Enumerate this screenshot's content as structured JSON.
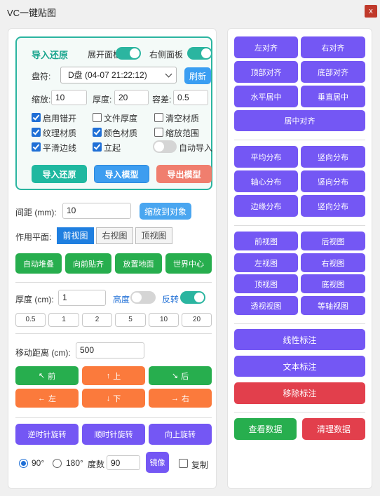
{
  "window": {
    "title": "VC一键贴图",
    "close_label": "x"
  },
  "import": {
    "section_title": "导入还原",
    "expand_panel_label": "展开面板",
    "side_panel_label": "右侧面板",
    "drive_label": "盘符:",
    "drive_value": "D盘 (04-07 21:22:12)",
    "refresh_label": "刷新",
    "scale_label": "缩放:",
    "scale_value": "10",
    "thickness_label": "厚度:",
    "thickness_value": "20",
    "tolerance_label": "容差:",
    "tolerance_value": "0.5",
    "checkboxes": [
      {
        "label": "启用错开",
        "checked": true
      },
      {
        "label": "文件厚度",
        "checked": false
      },
      {
        "label": "清空材质",
        "checked": false
      },
      {
        "label": "纹理材质",
        "checked": true
      },
      {
        "label": "颜色材质",
        "checked": true
      },
      {
        "label": "缩放范围",
        "checked": false
      },
      {
        "label": "平滑边线",
        "checked": true
      },
      {
        "label": "立起",
        "checked": true
      }
    ],
    "auto_import_label": "自动导入",
    "btn_restore": "导入还原",
    "btn_model": "导入模型",
    "btn_export": "导出模型"
  },
  "spacing": {
    "label": "间距 (mm):",
    "value": "10",
    "fit_button": "缩放到对象",
    "plane_label": "作用平面:",
    "planes": [
      "前视图",
      "右视图",
      "顶视图"
    ],
    "actions": [
      "自动堆叠",
      "向前贴齐",
      "放置地面",
      "世界中心"
    ]
  },
  "thickness": {
    "label": "厚度 (cm):",
    "value": "1",
    "height_label": "高度",
    "invert_label": "反转",
    "presets": [
      "0.5",
      "1",
      "2",
      "5",
      "10",
      "20"
    ]
  },
  "move": {
    "label": "移动距离 (cm):",
    "value": "500",
    "buttons": [
      "前",
      "上",
      "后",
      "左",
      "下",
      "右"
    ]
  },
  "rotate": {
    "buttons": [
      "逆时针旋转",
      "顺时针旋转",
      "向上旋转"
    ],
    "deg90": "90°",
    "deg180": "180°",
    "degree_label": "度数",
    "degree_value": "90",
    "mirror_label": "镜像",
    "copy_label": "复制"
  },
  "right": {
    "align": [
      "左对齐",
      "右对齐",
      "顶部对齐",
      "底部对齐",
      "水平居中",
      "垂直居中"
    ],
    "center_align": "居中对齐",
    "distribute": [
      "平均分布",
      "竖向分布",
      "轴心分布",
      "竖向分布",
      "边缘分布",
      "竖向分布"
    ],
    "views": [
      "前视图",
      "后视图",
      "左视图",
      "右视图",
      "顶视图",
      "底视图",
      "透视视图",
      "等轴视图"
    ],
    "line_annotation": "线性标注",
    "text_annotation": "文本标注",
    "remove_annotation": "移除标注",
    "view_data": "查看数据",
    "clear_data": "清理数据"
  },
  "colors": {
    "teal": "#1fb8a0",
    "purple": "#7457f4",
    "green": "#27ae4e",
    "orange": "#fb7a3c",
    "red": "#e23f4c"
  }
}
